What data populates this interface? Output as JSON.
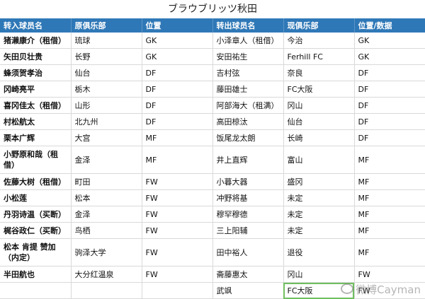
{
  "title": "ブラウブリッツ秋田",
  "headers": [
    "转入球员名",
    "原俱乐部",
    "位置",
    "转出球员名",
    "现俱乐部",
    "位置/数据"
  ],
  "rows": [
    [
      "猪濑康介（租借）",
      "琉球",
      "GK",
      "小泽章人（租借）",
      "今治",
      "GK"
    ],
    [
      "矢田贝壮贵",
      "长野",
      "GK",
      "安田祐生",
      "Ferhill FC",
      "GK"
    ],
    [
      "蜂须贺孝治",
      "仙台",
      "DF",
      "吉村弦",
      "奈良",
      "DF"
    ],
    [
      "冈崎亮平",
      "栃木",
      "DF",
      "藤田雄士",
      "FC大阪",
      "DF"
    ],
    [
      "喜冈佳太（租借）",
      "山形",
      "DF",
      "阿部海大（租满）",
      "冈山",
      "DF"
    ],
    [
      "村松航太",
      "北九州",
      "DF",
      "高田椋汰",
      "仙台",
      "DF"
    ],
    [
      "栗本广辉",
      "大宫",
      "MF",
      "饭尾龙太朗",
      "长崎",
      "DF"
    ],
    [
      "小野原和哉（租借）",
      "金泽",
      "MF",
      "井上直辉",
      "富山",
      "MF"
    ],
    [
      "佐藤大树（租借）",
      "町田",
      "FW",
      "小暮大器",
      "盛冈",
      "MF"
    ],
    [
      "小松莲",
      "松本",
      "FW",
      "冲野将基",
      "未定",
      "MF"
    ],
    [
      "丹羽诗温（买断）",
      "金泽",
      "FW",
      "穆罕穆德",
      "未定",
      "MF"
    ],
    [
      "梶谷政仁（买断）",
      "鸟栖",
      "FW",
      "三上阳辅",
      "未定",
      "MF"
    ],
    [
      "松本 肯提 赞加（内定）",
      "驹泽大学",
      "FW",
      "田中裕人",
      "退役",
      "MF"
    ],
    [
      "半田航也",
      "大分红温泉",
      "FW",
      "斋藤惠太",
      "冈山",
      "FW"
    ],
    [
      "",
      "",
      "",
      "武飒",
      "FC大阪",
      "FW"
    ]
  ],
  "watermark": "微博Cayman"
}
